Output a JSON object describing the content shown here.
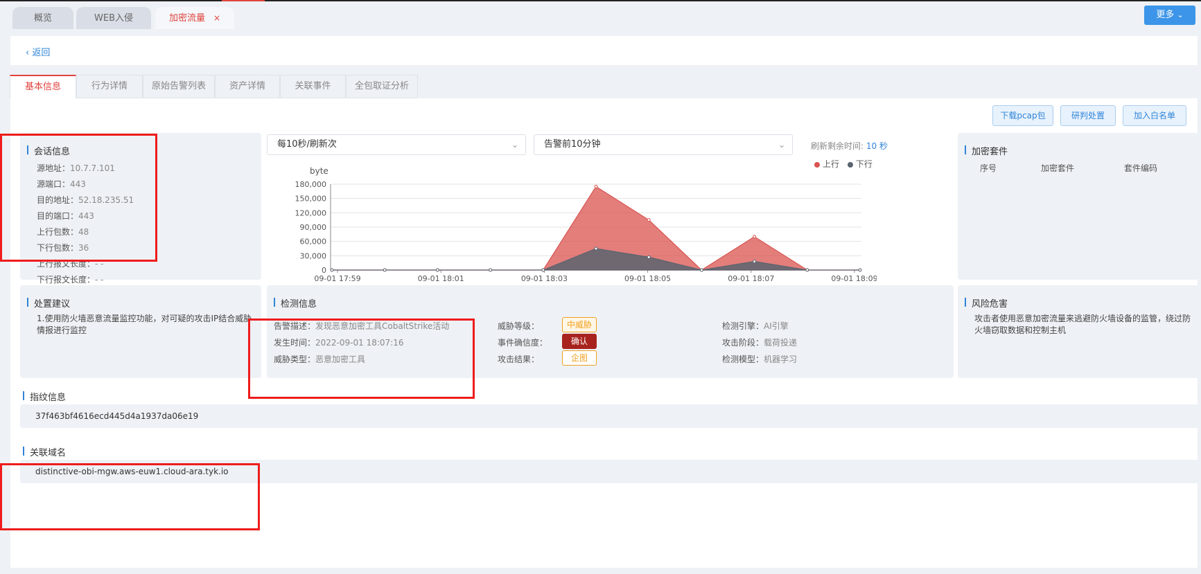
{
  "tabs": [
    {
      "label": "概览"
    },
    {
      "label": "WEB入侵"
    },
    {
      "label": "加密流量",
      "close": "×"
    }
  ],
  "more_button": "更多",
  "back_link": "返回",
  "subtabs": [
    "基本信息",
    "行为详情",
    "原始告警列表",
    "资产详情",
    "关联事件",
    "全包取证分析"
  ],
  "actions": [
    "下载pcap包",
    "研判处置",
    "加入白名单"
  ],
  "session": {
    "title": "会话信息",
    "rows": [
      {
        "label": "源地址：",
        "value": "10.7.7.101"
      },
      {
        "label": "源端口：",
        "value": "443"
      },
      {
        "label": "目的地址：",
        "value": "52.18.235.51"
      },
      {
        "label": "目的端口：",
        "value": "443"
      },
      {
        "label": "上行包数：",
        "value": "48"
      },
      {
        "label": "下行包数：",
        "value": "36"
      },
      {
        "label": "上行报文长度：",
        "value": "- -"
      },
      {
        "label": "下行报文长度：",
        "value": "- -"
      }
    ]
  },
  "chart_controls": {
    "refresh_select": "每10秒/刷新次",
    "range_select": "告警前10分钟",
    "countdown_label": "刷新剩余时间:",
    "countdown_value": "10 秒"
  },
  "chart_data": {
    "type": "area",
    "ylabel": "byte",
    "ylim": [
      0,
      180000
    ],
    "yticks": [
      "180,000",
      "150,000",
      "120,000",
      "90,000",
      "60,000",
      "30,000",
      "0"
    ],
    "xticks": [
      "09-01 17:59",
      "09-01 18:01",
      "09-01 18:03",
      "09-01 18:05",
      "09-01 18:07",
      "09-01 18:09"
    ],
    "x": [
      "17:59",
      "18:00",
      "18:01",
      "18:02",
      "18:03",
      "18:04",
      "18:05",
      "18:06",
      "18:07",
      "18:08",
      "18:09"
    ],
    "series": [
      {
        "name": "上行",
        "color": "#d9534f",
        "values": [
          0,
          0,
          0,
          0,
          0,
          175000,
          105000,
          0,
          70000,
          0,
          0
        ]
      },
      {
        "name": "下行",
        "color": "#5a6470",
        "values": [
          0,
          0,
          0,
          0,
          0,
          45000,
          27000,
          0,
          18000,
          0,
          0
        ]
      }
    ],
    "legend": "top-right"
  },
  "suites": {
    "title": "加密套件",
    "columns": [
      "序号",
      "加密套件",
      "套件编码"
    ]
  },
  "advice": {
    "title": "处置建议",
    "text": "1.使用防火墙恶意流量监控功能，对可疑的攻击IP结合威胁情报进行监控"
  },
  "detection": {
    "title": "检测信息",
    "rows": [
      {
        "label": "告警描述：",
        "value": "发现恶意加密工具CobaltStrike活动"
      },
      {
        "label": "发生时间：",
        "value": "2022-09-01 18:07:16"
      },
      {
        "label": "威胁类型：",
        "value": "恶意加密工具"
      }
    ],
    "mid": [
      {
        "label": "威胁等级：",
        "badge": "中威胁"
      },
      {
        "label": "事件确信度：",
        "badge": "确认"
      },
      {
        "label": "攻击结果：",
        "badge": "企图"
      }
    ],
    "right": [
      {
        "label": "检测引擎：",
        "value": "AI引擎"
      },
      {
        "label": "攻击阶段：",
        "value": "载荷投递"
      },
      {
        "label": "检测模型：",
        "value": "机器学习"
      }
    ]
  },
  "risk": {
    "title": "风险危害",
    "text": "攻击者使用恶意加密流量来逃避防火墙设备的监管，绕过防火墙窃取数据和控制主机"
  },
  "fingerprint": {
    "title": "指纹信息",
    "value": "37f463bf4616ecd445d4a1937da06e19"
  },
  "domain_info": {
    "title": "关联域名",
    "value": "distinctive-obi-mgw.aws-euw1.cloud-ara.tyk.io"
  }
}
